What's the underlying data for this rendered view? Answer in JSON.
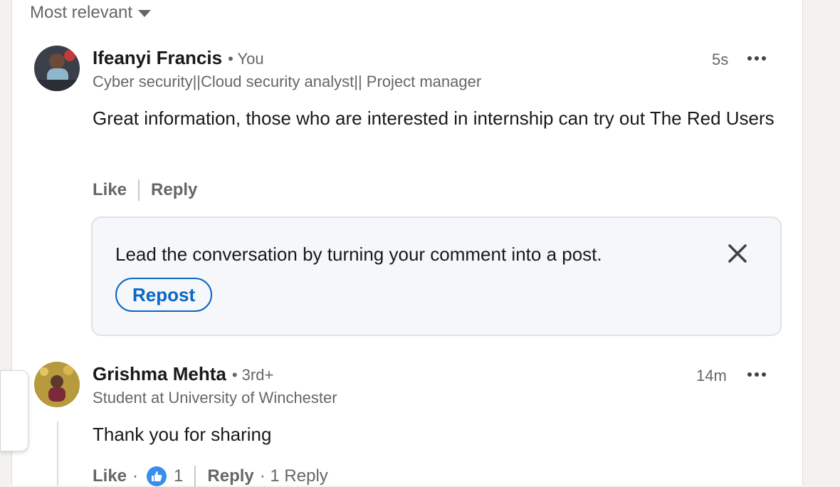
{
  "sort": {
    "label": "Most relevant"
  },
  "comments": [
    {
      "author": "Ifeanyi Francis",
      "relation": "• You",
      "headline": "Cyber security||Cloud security analyst|| Project manager",
      "time": "5s",
      "text": "Great information, those who are interested in internship can try out The Red Users",
      "like_label": "Like",
      "reply_label": "Reply"
    },
    {
      "author": "Grishma Mehta",
      "relation": "• 3rd+",
      "headline": "Student at University of Winchester",
      "time": "14m",
      "text": "Thank you for sharing",
      "like_label": "Like",
      "like_sep": "·",
      "reaction_count": "1",
      "reply_label": "Reply",
      "replies_label": "· 1 Reply"
    }
  ],
  "prompt": {
    "text": "Lead the conversation by turning your comment into a post.",
    "button_label": "Repost"
  },
  "colors": {
    "accent": "#0a66c2",
    "reaction": "#378fe9"
  },
  "icons": {
    "sort": "chevron-down-icon",
    "more": "more-horizontal-icon",
    "close": "close-icon",
    "reaction": "like-thumb-icon"
  }
}
